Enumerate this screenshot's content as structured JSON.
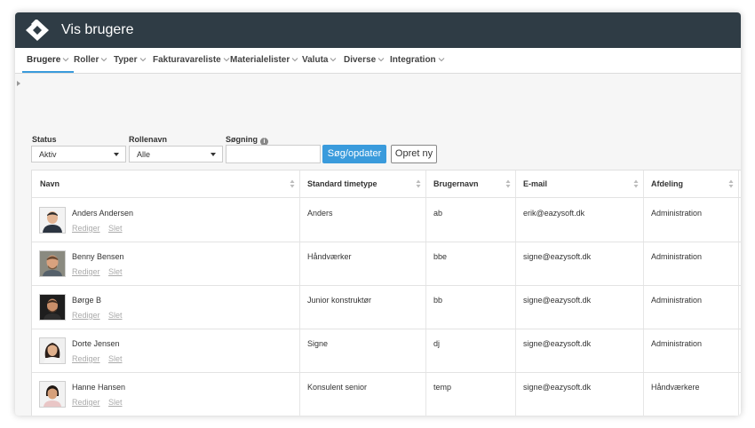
{
  "app": {
    "title": "Vis brugere"
  },
  "menu": [
    {
      "label": "Brugere",
      "active": true
    },
    {
      "label": "Roller"
    },
    {
      "label": "Typer"
    },
    {
      "label": "Fakturavareliste"
    },
    {
      "label": "Materialelister"
    },
    {
      "label": "Valuta"
    },
    {
      "label": "Diverse"
    },
    {
      "label": "Integration"
    }
  ],
  "filters": {
    "status_label": "Status",
    "status_value": "Aktiv",
    "role_label": "Rollenavn",
    "role_value": "Alle",
    "search_label": "Søgning",
    "search_value": "",
    "search_button": "Søg/opdater",
    "create_button": "Opret ny"
  },
  "table": {
    "columns": [
      "Navn",
      "Standard timetype",
      "Brugernavn",
      "E-mail",
      "Afdeling"
    ],
    "edit_label": "Rediger",
    "delete_label": "Slet",
    "rows": [
      {
        "name": "Anders Andersen",
        "timetype": "Anders",
        "username": "ab",
        "email": "erik@eazysoft.dk",
        "department": "Administration"
      },
      {
        "name": "Benny Bensen",
        "timetype": "Håndværker",
        "username": "bbe",
        "email": "signe@eazysoft.dk",
        "department": "Administration"
      },
      {
        "name": "Børge B",
        "timetype": "Junior konstruktør",
        "username": "bb",
        "email": "signe@eazysoft.dk",
        "department": "Administration"
      },
      {
        "name": "Dorte Jensen",
        "timetype": "Signe",
        "username": "dj",
        "email": "signe@eazysoft.dk",
        "department": "Administration"
      },
      {
        "name": "Hanne Hansen",
        "timetype": "Konsulent senior",
        "username": "temp",
        "email": "signe@eazysoft.dk",
        "department": "Håndværkere"
      }
    ]
  },
  "colors": {
    "header_bg": "#2f3c45",
    "accent": "#3a9bdc"
  }
}
